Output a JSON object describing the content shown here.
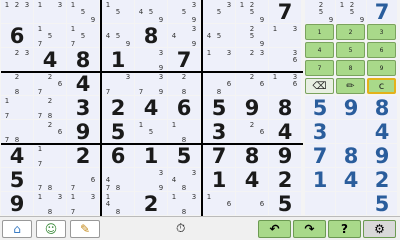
{
  "board": {
    "rows": [
      [
        {
          "big": null,
          "notes": [
            1,
            2,
            3
          ]
        },
        {
          "big": null,
          "notes": [
            1,
            3
          ]
        },
        {
          "big": null,
          "notes": [
            1,
            5,
            9
          ]
        },
        {
          "big": null,
          "notes": [
            1,
            5
          ]
        },
        {
          "big": null,
          "notes": [
            4,
            5,
            9
          ]
        },
        {
          "big": null,
          "notes": [
            3,
            5,
            9
          ]
        },
        {
          "big": null,
          "notes": [
            3,
            5
          ]
        },
        {
          "big": null,
          "notes": [
            1,
            2,
            5,
            9
          ]
        },
        {
          "big": "7",
          "notes": []
        }
      ],
      [
        {
          "big": "6",
          "notes": []
        },
        {
          "big": null,
          "notes": [
            1,
            5,
            7
          ]
        },
        {
          "big": null,
          "notes": [
            1,
            5,
            7
          ]
        },
        {
          "big": null,
          "notes": [
            4,
            5,
            9
          ]
        },
        {
          "big": "8",
          "notes": []
        },
        {
          "big": null,
          "notes": [
            3,
            4,
            9
          ]
        },
        {
          "big": null,
          "notes": [
            4,
            5
          ]
        },
        {
          "big": null,
          "notes": [
            2,
            5,
            9
          ]
        },
        {
          "big": null,
          "notes": [
            1,
            3
          ]
        }
      ],
      [
        {
          "big": null,
          "notes": [
            2,
            3
          ]
        },
        {
          "big": "4",
          "notes": []
        },
        {
          "big": "8",
          "notes": []
        },
        {
          "big": "1",
          "notes": []
        },
        {
          "big": null,
          "notes": [
            3,
            9
          ]
        },
        {
          "big": "7",
          "notes": []
        },
        {
          "big": null,
          "notes": [
            1,
            3
          ]
        },
        {
          "big": null,
          "notes": [
            2,
            3
          ]
        },
        {
          "big": null,
          "notes": [
            3,
            6
          ]
        }
      ],
      [
        {
          "big": null,
          "notes": [
            2,
            8
          ]
        },
        {
          "big": null,
          "notes": [
            2,
            6,
            7
          ]
        },
        {
          "big": "4",
          "notes": []
        },
        {
          "big": null,
          "notes": [
            3,
            7
          ]
        },
        {
          "big": null,
          "notes": [
            3,
            7,
            9
          ]
        },
        {
          "big": null,
          "notes": [
            2,
            8
          ]
        },
        {
          "big": null,
          "notes": [
            6,
            8
          ]
        },
        {
          "big": null,
          "notes": [
            2,
            6
          ]
        },
        {
          "big": null,
          "notes": [
            1,
            3,
            6
          ]
        }
      ],
      [
        {
          "big": null,
          "notes": [
            1,
            7
          ]
        },
        {
          "big": null,
          "notes": [
            2,
            7,
            8
          ]
        },
        {
          "big": "3",
          "notes": []
        },
        {
          "big": "2",
          "notes": []
        },
        {
          "big": "4",
          "notes": []
        },
        {
          "big": "6",
          "notes": []
        },
        {
          "big": "5",
          "notes": []
        },
        {
          "big": "9",
          "notes": []
        },
        {
          "big": "8",
          "notes": []
        }
      ],
      [
        {
          "big": null,
          "notes": [
            7,
            8
          ]
        },
        {
          "big": null,
          "notes": [
            2,
            6
          ]
        },
        {
          "big": "9",
          "notes": []
        },
        {
          "big": "5",
          "notes": []
        },
        {
          "big": null,
          "notes": [
            1,
            5
          ]
        },
        {
          "big": null,
          "notes": [
            1,
            8
          ]
        },
        {
          "big": "3",
          "notes": []
        },
        {
          "big": null,
          "notes": [
            2,
            6
          ]
        },
        {
          "big": "4",
          "notes": []
        }
      ],
      [
        {
          "big": "4",
          "notes": []
        },
        {
          "big": null,
          "notes": [
            1,
            7
          ]
        },
        {
          "big": "2",
          "notes": []
        },
        {
          "big": "6",
          "notes": []
        },
        {
          "big": "1",
          "notes": []
        },
        {
          "big": "5",
          "notes": []
        },
        {
          "big": "7",
          "notes": []
        },
        {
          "big": "8",
          "notes": []
        },
        {
          "big": "9",
          "notes": []
        }
      ],
      [
        {
          "big": "5",
          "notes": []
        },
        {
          "big": null,
          "notes": [
            7,
            8
          ]
        },
        {
          "big": null,
          "notes": [
            6,
            7
          ]
        },
        {
          "big": null,
          "notes": [
            4,
            7,
            8
          ]
        },
        {
          "big": null,
          "notes": [
            3,
            9
          ]
        },
        {
          "big": null,
          "notes": [
            3,
            4,
            8
          ]
        },
        {
          "big": "1",
          "notes": []
        },
        {
          "big": "4",
          "notes": []
        },
        {
          "big": "2",
          "notes": []
        }
      ],
      [
        {
          "big": "9",
          "notes": []
        },
        {
          "big": null,
          "notes": [
            1,
            3,
            8
          ]
        },
        {
          "big": null,
          "notes": [
            1,
            3,
            7
          ]
        },
        {
          "big": null,
          "notes": [
            1,
            4,
            8
          ]
        },
        {
          "big": "2",
          "notes": []
        },
        {
          "big": null,
          "notes": [
            1,
            3,
            8
          ]
        },
        {
          "big": null,
          "notes": [
            1,
            6
          ]
        },
        {
          "big": null,
          "notes": [
            6
          ]
        },
        {
          "big": "5",
          "notes": []
        }
      ]
    ]
  },
  "panel": {
    "top_cells": [
      {
        "big": null,
        "notes": [
          2,
          5,
          9
        ]
      },
      {
        "big": null,
        "notes": [
          1,
          2,
          5,
          9
        ]
      },
      {
        "big": "7",
        "notes": []
      }
    ],
    "keypad_keys": [
      "1",
      "2",
      "3",
      "4",
      "5",
      "6",
      "7",
      "8",
      "9"
    ],
    "tools": [
      {
        "label": "eraser",
        "icon": "eraser-icon"
      },
      {
        "label": "pencil",
        "icon": "pencil-icon"
      },
      {
        "label": "c",
        "icon": "clear-icon"
      }
    ],
    "side_rows": [
      [
        "5",
        "9",
        "8"
      ],
      [
        "3",
        "",
        "4"
      ],
      [
        "7",
        "8",
        "9"
      ],
      [
        "1",
        "4",
        "2"
      ],
      [
        "",
        "",
        "5"
      ]
    ],
    "side_row_notes": [
      [],
      [
        [
          6
        ]
      ],
      [],
      [],
      [
        [
          1,
          6
        ],
        [
          6
        ]
      ]
    ]
  },
  "toolbar": {
    "left": [
      {
        "name": "home-button",
        "icon": "home-icon",
        "glyph": "⌂"
      },
      {
        "name": "hint-person-button",
        "icon": "person-icon",
        "glyph": "☺"
      },
      {
        "name": "notes-button",
        "icon": "notes-icon",
        "glyph": "✎"
      }
    ],
    "clock_icon": "clock-icon",
    "clock_glyph": "⏱",
    "right": [
      {
        "name": "undo-button",
        "icon": "undo-icon",
        "glyph": "↶"
      },
      {
        "name": "redo-button",
        "icon": "redo-icon",
        "glyph": "↷"
      },
      {
        "name": "help-button",
        "icon": "help-icon",
        "glyph": "?"
      },
      {
        "name": "settings-button",
        "icon": "settings-icon",
        "glyph": "⚙"
      }
    ]
  },
  "colors": {
    "given_digit": "#1a1a1a",
    "user_digit": "#2a5d9c",
    "cell_bg": "#eef0fa",
    "key_green": "#a9d98a",
    "select_gold": "#e3b21a"
  }
}
